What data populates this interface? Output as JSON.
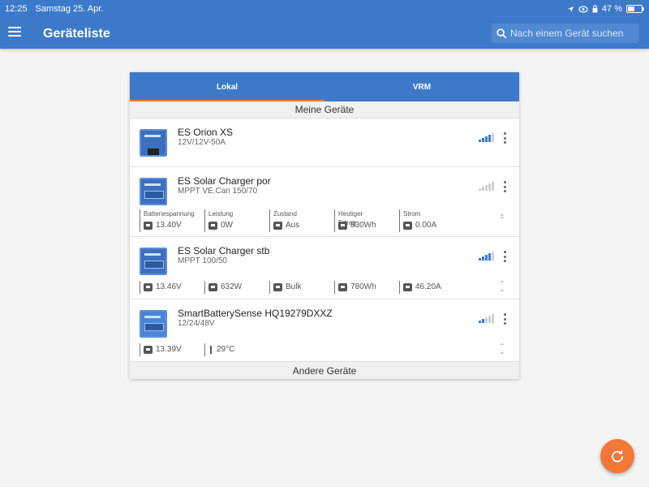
{
  "status_bar": {
    "time": "12:25",
    "date": "Samstag 25. Apr.",
    "battery_percent": "47 %",
    "battery_level": 0.47
  },
  "header": {
    "title": "Geräteliste",
    "search_placeholder": "Nach einem Gerät suchen"
  },
  "tabs": [
    {
      "label": "Lokal",
      "active": true
    },
    {
      "label": "VRM",
      "active": false
    }
  ],
  "sections": {
    "my_devices": "Meine Geräte",
    "other_devices": "Andere Geräte"
  },
  "devices": [
    {
      "name": "ES Orion XS",
      "model": "12V/12V-50A",
      "signal_bars": 4
    },
    {
      "name": "ES Solar Charger por",
      "model": "MPPT VE.Can 150/70",
      "signal_bars": 0,
      "metrics": [
        {
          "label": "Batteriespannung",
          "value": "13.40V",
          "icon": "battery-icon"
        },
        {
          "label": "Leistung",
          "value": "0W",
          "icon": "solar-panel-icon"
        },
        {
          "label": "Zustand",
          "value": "Aus",
          "icon": "state-icon"
        },
        {
          "label": "Heutiger Ertrag",
          "value": "830Wh",
          "icon": "yield-icon"
        },
        {
          "label": "Strom",
          "value": "0.00A",
          "icon": "current-icon"
        }
      ]
    },
    {
      "name": "ES Solar Charger stb",
      "model": "MPPT 100/50",
      "signal_bars": 4,
      "metrics": [
        {
          "value": "13.46V",
          "icon": "battery-icon"
        },
        {
          "value": "632W",
          "icon": "solar-panel-icon"
        },
        {
          "value": "Bulk",
          "icon": "state-icon"
        },
        {
          "value": "780Wh",
          "icon": "yield-icon"
        },
        {
          "value": "46.20A",
          "icon": "current-icon"
        }
      ]
    },
    {
      "name": "SmartBatterySense HQ19279DXXZ",
      "model": "12/24/48V",
      "signal_bars": 2,
      "metrics": [
        {
          "value": "13.39V",
          "icon": "battery-icon"
        },
        {
          "value": "29°C",
          "icon": "thermometer-icon"
        }
      ]
    }
  ],
  "colors": {
    "primary": "#3c7ac9",
    "accent": "#f37736",
    "background": "#f4f4f4"
  }
}
